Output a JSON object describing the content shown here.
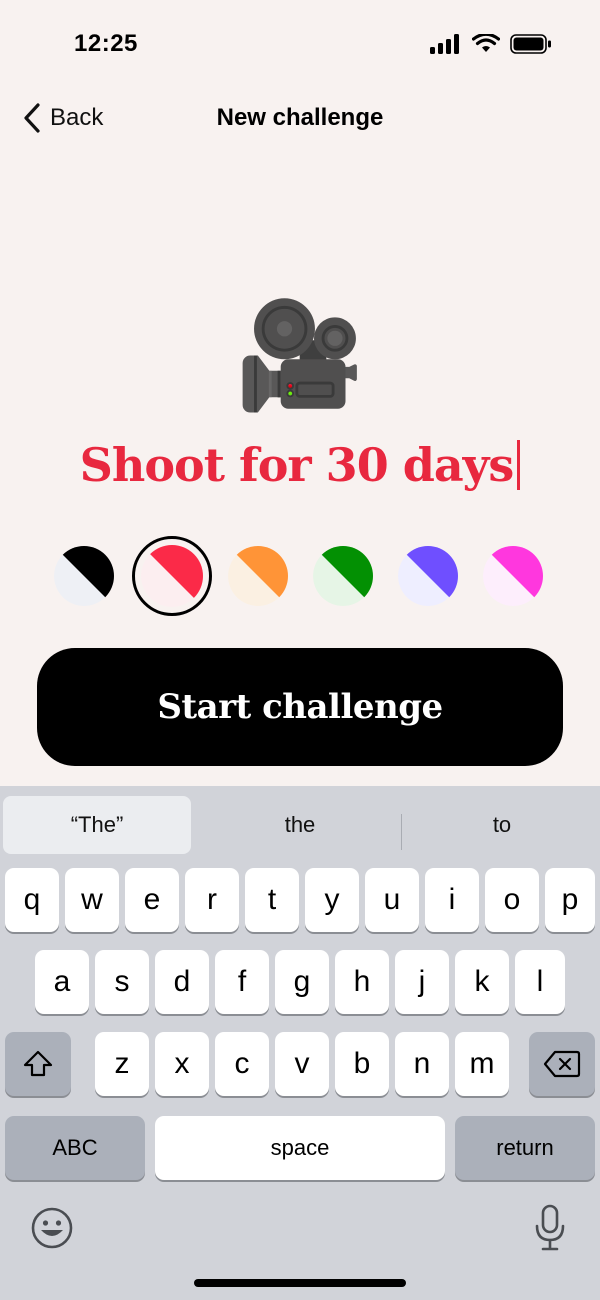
{
  "status_bar": {
    "time": "12:25"
  },
  "nav": {
    "back_label": "Back",
    "title": "New challenge"
  },
  "challenge": {
    "emoji": "🎥",
    "title": "Shoot for 30 days"
  },
  "swatches": [
    {
      "name": "black",
      "color": "#000000",
      "tint": "#eef0f5",
      "selected": false
    },
    {
      "name": "red",
      "color": "#fb2a48",
      "tint": "#fceef0",
      "selected": true
    },
    {
      "name": "orange",
      "color": "#ff9437",
      "tint": "#fbf0e2",
      "selected": false
    },
    {
      "name": "green",
      "color": "#039003",
      "tint": "#e6f5e6",
      "selected": false
    },
    {
      "name": "purple",
      "color": "#6f4fff",
      "tint": "#eeeeff",
      "selected": false
    },
    {
      "name": "pink",
      "color": "#ff37de",
      "tint": "#fdeefc",
      "selected": false
    }
  ],
  "start_button": {
    "label": "Start challenge"
  },
  "keyboard": {
    "suggestions": [
      "“The”",
      "the",
      "to"
    ],
    "row1": [
      "q",
      "w",
      "e",
      "r",
      "t",
      "y",
      "u",
      "i",
      "o",
      "p"
    ],
    "row2": [
      "a",
      "s",
      "d",
      "f",
      "g",
      "h",
      "j",
      "k",
      "l"
    ],
    "row3": [
      "z",
      "x",
      "c",
      "v",
      "b",
      "n",
      "m"
    ],
    "abc_label": "ABC",
    "space_label": "space",
    "return_label": "return"
  }
}
